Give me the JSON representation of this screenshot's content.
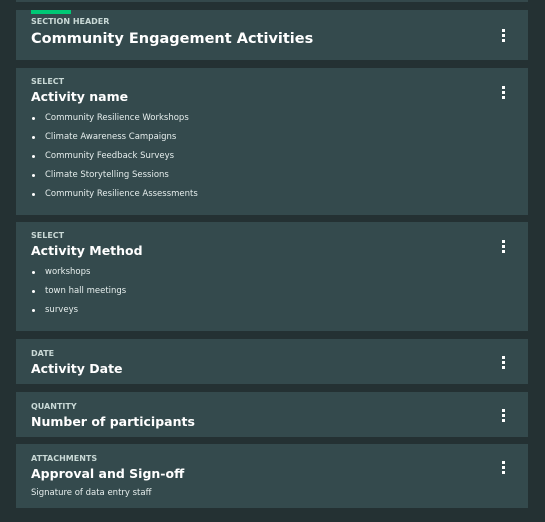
{
  "cards": [
    {
      "type": "SECTION HEADER",
      "title": "Community Engagement Activities",
      "accent_color": "#00c875"
    },
    {
      "type": "SELECT",
      "title": "Activity name",
      "options": [
        "Community Resilience Workshops",
        "Climate Awareness Campaigns",
        "Community Feedback Surveys",
        "Climate Storytelling Sessions",
        "Community Resilience Assessments"
      ]
    },
    {
      "type": "SELECT",
      "title": "Activity Method",
      "options": [
        "workshops",
        "town hall meetings",
        "surveys"
      ]
    },
    {
      "type": "DATE",
      "title": "Activity Date"
    },
    {
      "type": "QUANTITY",
      "title": "Number of participants"
    },
    {
      "type": "ATTACHMENTS",
      "title": "Approval and Sign-off",
      "description": "Signature of data entry staff"
    }
  ],
  "icons": {
    "menu": "more-vertical-icon"
  }
}
